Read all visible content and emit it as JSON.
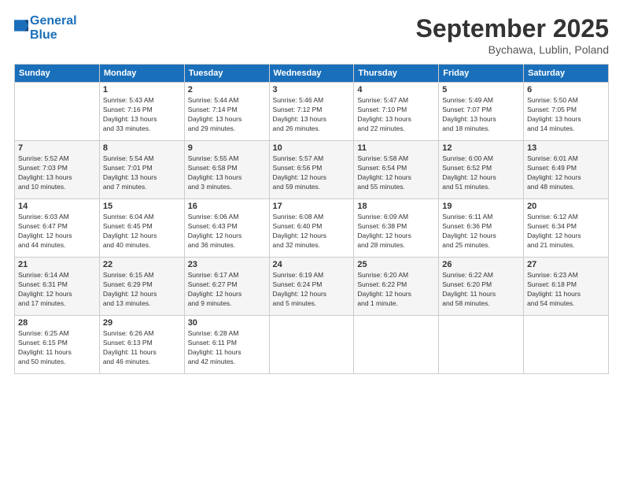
{
  "header": {
    "logo_line1": "General",
    "logo_line2": "Blue",
    "month": "September 2025",
    "location": "Bychawa, Lublin, Poland"
  },
  "days_of_week": [
    "Sunday",
    "Monday",
    "Tuesday",
    "Wednesday",
    "Thursday",
    "Friday",
    "Saturday"
  ],
  "weeks": [
    [
      {
        "day": "",
        "info": ""
      },
      {
        "day": "1",
        "info": "Sunrise: 5:43 AM\nSunset: 7:16 PM\nDaylight: 13 hours\nand 33 minutes."
      },
      {
        "day": "2",
        "info": "Sunrise: 5:44 AM\nSunset: 7:14 PM\nDaylight: 13 hours\nand 29 minutes."
      },
      {
        "day": "3",
        "info": "Sunrise: 5:46 AM\nSunset: 7:12 PM\nDaylight: 13 hours\nand 26 minutes."
      },
      {
        "day": "4",
        "info": "Sunrise: 5:47 AM\nSunset: 7:10 PM\nDaylight: 13 hours\nand 22 minutes."
      },
      {
        "day": "5",
        "info": "Sunrise: 5:49 AM\nSunset: 7:07 PM\nDaylight: 13 hours\nand 18 minutes."
      },
      {
        "day": "6",
        "info": "Sunrise: 5:50 AM\nSunset: 7:05 PM\nDaylight: 13 hours\nand 14 minutes."
      }
    ],
    [
      {
        "day": "7",
        "info": "Sunrise: 5:52 AM\nSunset: 7:03 PM\nDaylight: 13 hours\nand 10 minutes."
      },
      {
        "day": "8",
        "info": "Sunrise: 5:54 AM\nSunset: 7:01 PM\nDaylight: 13 hours\nand 7 minutes."
      },
      {
        "day": "9",
        "info": "Sunrise: 5:55 AM\nSunset: 6:58 PM\nDaylight: 13 hours\nand 3 minutes."
      },
      {
        "day": "10",
        "info": "Sunrise: 5:57 AM\nSunset: 6:56 PM\nDaylight: 12 hours\nand 59 minutes."
      },
      {
        "day": "11",
        "info": "Sunrise: 5:58 AM\nSunset: 6:54 PM\nDaylight: 12 hours\nand 55 minutes."
      },
      {
        "day": "12",
        "info": "Sunrise: 6:00 AM\nSunset: 6:52 PM\nDaylight: 12 hours\nand 51 minutes."
      },
      {
        "day": "13",
        "info": "Sunrise: 6:01 AM\nSunset: 6:49 PM\nDaylight: 12 hours\nand 48 minutes."
      }
    ],
    [
      {
        "day": "14",
        "info": "Sunrise: 6:03 AM\nSunset: 6:47 PM\nDaylight: 12 hours\nand 44 minutes."
      },
      {
        "day": "15",
        "info": "Sunrise: 6:04 AM\nSunset: 6:45 PM\nDaylight: 12 hours\nand 40 minutes."
      },
      {
        "day": "16",
        "info": "Sunrise: 6:06 AM\nSunset: 6:43 PM\nDaylight: 12 hours\nand 36 minutes."
      },
      {
        "day": "17",
        "info": "Sunrise: 6:08 AM\nSunset: 6:40 PM\nDaylight: 12 hours\nand 32 minutes."
      },
      {
        "day": "18",
        "info": "Sunrise: 6:09 AM\nSunset: 6:38 PM\nDaylight: 12 hours\nand 28 minutes."
      },
      {
        "day": "19",
        "info": "Sunrise: 6:11 AM\nSunset: 6:36 PM\nDaylight: 12 hours\nand 25 minutes."
      },
      {
        "day": "20",
        "info": "Sunrise: 6:12 AM\nSunset: 6:34 PM\nDaylight: 12 hours\nand 21 minutes."
      }
    ],
    [
      {
        "day": "21",
        "info": "Sunrise: 6:14 AM\nSunset: 6:31 PM\nDaylight: 12 hours\nand 17 minutes."
      },
      {
        "day": "22",
        "info": "Sunrise: 6:15 AM\nSunset: 6:29 PM\nDaylight: 12 hours\nand 13 minutes."
      },
      {
        "day": "23",
        "info": "Sunrise: 6:17 AM\nSunset: 6:27 PM\nDaylight: 12 hours\nand 9 minutes."
      },
      {
        "day": "24",
        "info": "Sunrise: 6:19 AM\nSunset: 6:24 PM\nDaylight: 12 hours\nand 5 minutes."
      },
      {
        "day": "25",
        "info": "Sunrise: 6:20 AM\nSunset: 6:22 PM\nDaylight: 12 hours\nand 1 minute."
      },
      {
        "day": "26",
        "info": "Sunrise: 6:22 AM\nSunset: 6:20 PM\nDaylight: 11 hours\nand 58 minutes."
      },
      {
        "day": "27",
        "info": "Sunrise: 6:23 AM\nSunset: 6:18 PM\nDaylight: 11 hours\nand 54 minutes."
      }
    ],
    [
      {
        "day": "28",
        "info": "Sunrise: 6:25 AM\nSunset: 6:15 PM\nDaylight: 11 hours\nand 50 minutes."
      },
      {
        "day": "29",
        "info": "Sunrise: 6:26 AM\nSunset: 6:13 PM\nDaylight: 11 hours\nand 46 minutes."
      },
      {
        "day": "30",
        "info": "Sunrise: 6:28 AM\nSunset: 6:11 PM\nDaylight: 11 hours\nand 42 minutes."
      },
      {
        "day": "",
        "info": ""
      },
      {
        "day": "",
        "info": ""
      },
      {
        "day": "",
        "info": ""
      },
      {
        "day": "",
        "info": ""
      }
    ]
  ]
}
